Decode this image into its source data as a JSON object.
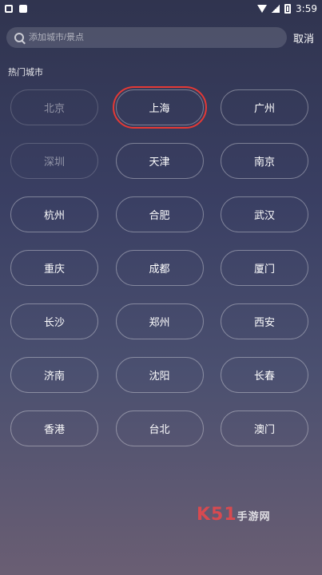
{
  "status_bar": {
    "time": "3:59"
  },
  "search": {
    "placeholder": "添加城市/景点"
  },
  "actions": {
    "cancel": "取消"
  },
  "section": {
    "title": "热门城市"
  },
  "cities": [
    {
      "label": "北京",
      "muted": true
    },
    {
      "label": "上海",
      "selected": true
    },
    {
      "label": "广州"
    },
    {
      "label": "深圳",
      "muted": true
    },
    {
      "label": "天津"
    },
    {
      "label": "南京"
    },
    {
      "label": "杭州"
    },
    {
      "label": "合肥"
    },
    {
      "label": "武汉"
    },
    {
      "label": "重庆"
    },
    {
      "label": "成都"
    },
    {
      "label": "厦门"
    },
    {
      "label": "长沙"
    },
    {
      "label": "郑州"
    },
    {
      "label": "西安"
    },
    {
      "label": "济南"
    },
    {
      "label": "沈阳"
    },
    {
      "label": "长春"
    },
    {
      "label": "香港"
    },
    {
      "label": "台北"
    },
    {
      "label": "澳门"
    }
  ],
  "watermark": {
    "text": "K51",
    "suffix": "手游网"
  }
}
